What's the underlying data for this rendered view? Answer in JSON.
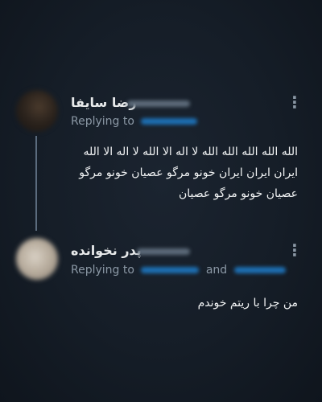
{
  "tweets": [
    {
      "display_name": "رضا سایفا",
      "replying_label": "Replying to",
      "lines": [
        "الله الله الله الله الله لا اله الا الله لا اله الا الله",
        "ایران ایران ایران خونو مرگو عصیان خونو مرگو",
        "عصیان خونو مرگو عصیان"
      ],
      "more_label": "⋮"
    },
    {
      "display_name": "پدر نخوانده",
      "replying_label": "Replying to",
      "and_label": "and",
      "lines": [
        "من چرا با ریتم خوندم"
      ],
      "more_label": "⋮"
    }
  ]
}
